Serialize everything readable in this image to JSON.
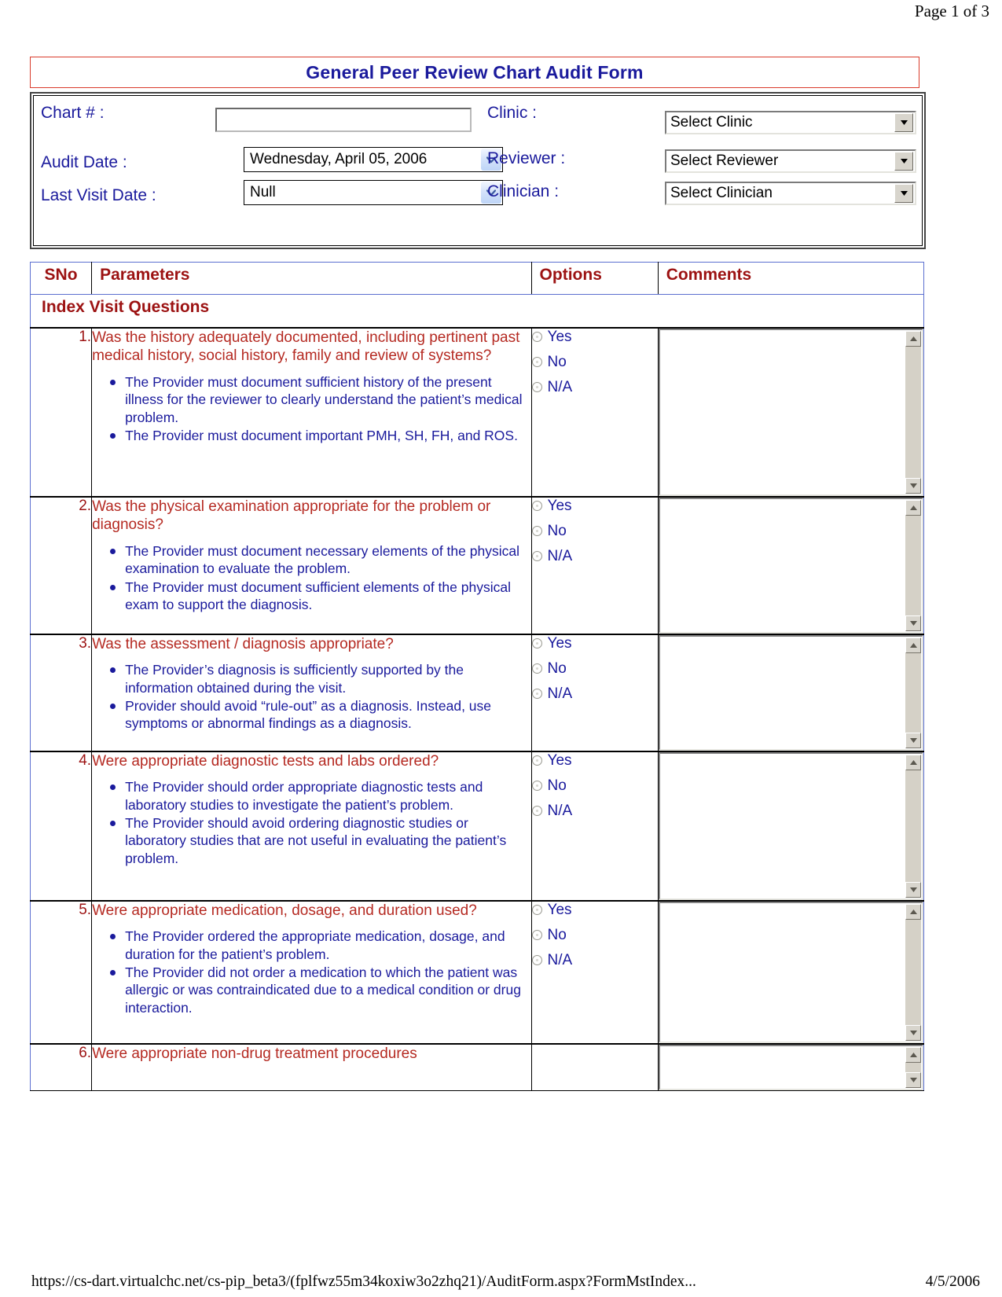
{
  "page": {
    "page_indicator": "Page 1 of 3",
    "title": "General Peer Review Chart Audit Form"
  },
  "form_header": {
    "chart_label": "Chart # :",
    "chart_value": "",
    "chart_placeholder": "",
    "audit_date_label": "Audit Date :",
    "audit_date_value": "Wednesday, April 05, 2006",
    "last_visit_label": "Last Visit Date :",
    "last_visit_value": "Null",
    "clinic_label": "Clinic :",
    "clinic_value": "Select Clinic",
    "reviewer_label": "Reviewer :",
    "reviewer_value": "Select Reviewer",
    "clinician_label": "Clinician :",
    "clinician_value": "Select Clinician"
  },
  "table": {
    "headers": {
      "sno": "SNo",
      "parameters": "Parameters",
      "options": "Options",
      "comments": "Comments"
    },
    "section_title": "Index Visit Questions",
    "options_labels": [
      "Yes",
      "No",
      "N/A"
    ],
    "rows": [
      {
        "sno": "1.",
        "question": "Was the history adequately documented, including pertinent past medical history, social history, family and review of systems?",
        "bullets": [
          "The Provider must document sufficient history of the present illness for the reviewer to clearly understand the patient’s medical problem.",
          "The Provider must document important PMH, SH, FH, and ROS."
        ],
        "options": [
          "Yes",
          "No",
          "N/A"
        ],
        "selected": "",
        "comment": ""
      },
      {
        "sno": "2.",
        "question": "Was the physical examination appropriate for the problem or diagnosis?",
        "bullets": [
          "The Provider must document necessary elements of the physical examination to evaluate the problem.",
          "The Provider must document sufficient elements of the physical exam to support the diagnosis."
        ],
        "options": [
          "Yes",
          "No",
          "N/A"
        ],
        "selected": "",
        "comment": ""
      },
      {
        "sno": "3.",
        "question": "Was the assessment / diagnosis appropriate?",
        "bullets": [
          "The Provider’s diagnosis is sufficiently supported by the information obtained during the visit.",
          "Provider should avoid “rule-out” as a diagnosis. Instead, use symptoms or abnormal findings as a diagnosis."
        ],
        "options": [
          "Yes",
          "No",
          "N/A"
        ],
        "selected": "",
        "comment": ""
      },
      {
        "sno": "4.",
        "question": "Were appropriate diagnostic tests and labs ordered?",
        "bullets": [
          "The Provider should order appropriate diagnostic tests and laboratory studies to investigate the patient’s problem.",
          "The Provider should avoid ordering diagnostic studies or laboratory studies that are not useful in evaluating the patient’s problem."
        ],
        "options": [
          "Yes",
          "No",
          "N/A"
        ],
        "selected": "",
        "comment": ""
      },
      {
        "sno": "5.",
        "question": "Were appropriate medication, dosage, and duration used?",
        "bullets": [
          "The Provider ordered the appropriate medication, dosage, and duration for the patient’s problem.",
          "The Provider did not order a medication to which the patient was allergic or was contraindicated due to a medical condition or drug interaction."
        ],
        "options": [
          "Yes",
          "No",
          "N/A"
        ],
        "selected": "",
        "comment": ""
      },
      {
        "sno": "6.",
        "question": "Were appropriate non-drug treatment procedures",
        "bullets": [],
        "options": [],
        "selected": "",
        "comment": ""
      }
    ]
  },
  "footer": {
    "url": "https://cs-dart.virtualchc.net/cs-pip_beta3/(fplfwz55m34koxiw3o2zhq21)/AuditForm.aspx?FormMstIndex...",
    "date": "4/5/2006"
  },
  "colors": {
    "title_blue": "#1a1a9c",
    "heading_red": "#9c1212",
    "question_red": "#b52a22",
    "bullet_blue": "#1a1a9c",
    "title_border_red": "#d93b2b",
    "grid_border_blue": "#5b6fd0"
  }
}
